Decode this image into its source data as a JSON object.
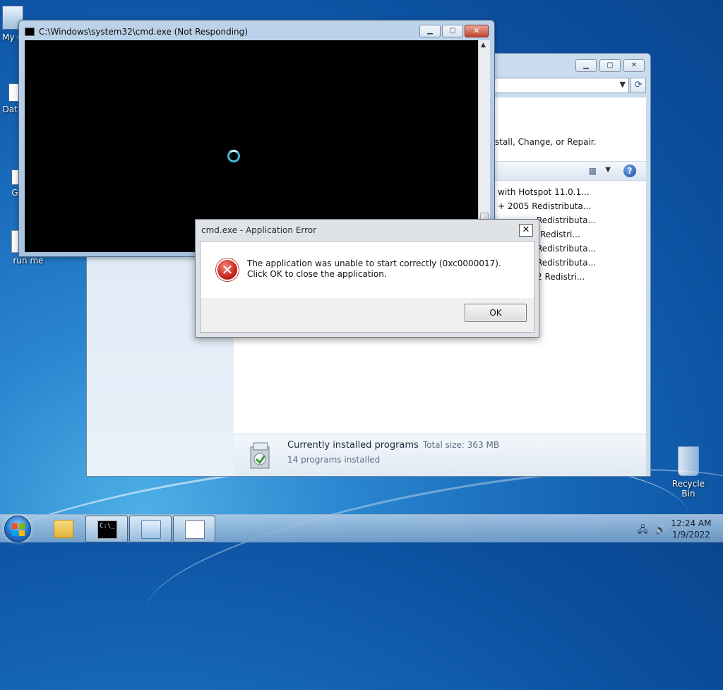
{
  "desktop": {
    "icons": [
      {
        "label": "My C"
      },
      {
        "label": "Data"
      },
      {
        "label": "G"
      },
      {
        "label": "run me"
      },
      {
        "label": "Recycle Bin"
      }
    ]
  },
  "programs_window": {
    "description": "stall, Change, or Repair.",
    "list_items": [
      "with Hotspot 11.0.1...",
      "+ 2005 Redistributa...",
      "Redistributa...",
      "Redistri...",
      "Redistributa...",
      "Redistributa...",
      "2 Redistri..."
    ],
    "status": {
      "title": "Currently installed programs",
      "size_label": "Total size: 363 MB",
      "count": "14 programs installed"
    }
  },
  "cmd_window": {
    "title": "C:\\Windows\\system32\\cmd.exe (Not Responding)"
  },
  "error_dialog": {
    "title": "cmd.exe - Application Error",
    "message": "The application was unable to start correctly (0xc0000017). Click OK to close the application.",
    "ok_label": "OK"
  },
  "taskbar": {
    "time": "12:24 AM",
    "date": "1/9/2022"
  },
  "colors": {
    "desktop_blue": "#1563b3",
    "error_red": "#c5261c"
  }
}
